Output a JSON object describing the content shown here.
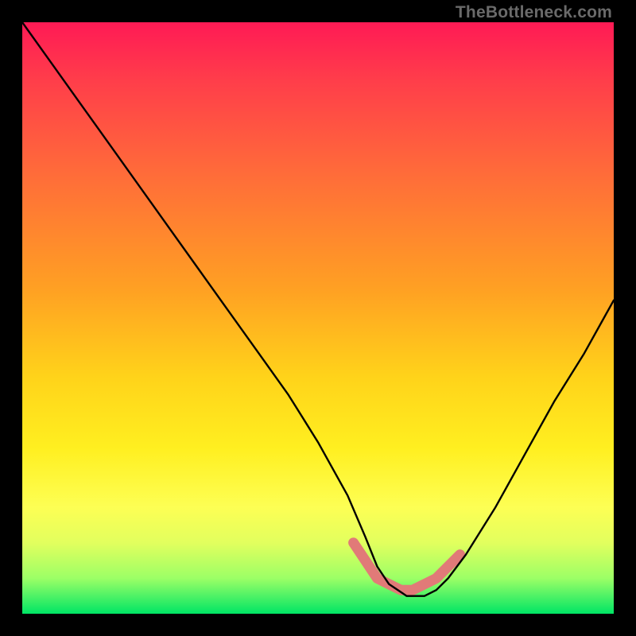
{
  "watermark": "TheBottleneck.com",
  "chart_data": {
    "type": "line",
    "title": "",
    "xlabel": "",
    "ylabel": "",
    "xlim": [
      0,
      100
    ],
    "ylim": [
      0,
      100
    ],
    "series": [
      {
        "name": "bottleneck-curve",
        "x": [
          0,
          5,
          10,
          15,
          20,
          25,
          30,
          35,
          40,
          45,
          50,
          55,
          58,
          60,
          62,
          65,
          68,
          70,
          72,
          75,
          80,
          85,
          90,
          95,
          100
        ],
        "values": [
          100,
          93,
          86,
          79,
          72,
          65,
          58,
          51,
          44,
          37,
          29,
          20,
          13,
          8,
          5,
          3,
          3,
          4,
          6,
          10,
          18,
          27,
          36,
          44,
          53
        ]
      }
    ],
    "highlight_band": {
      "name": "optimal-range",
      "x": [
        56,
        58,
        60,
        62,
        64,
        66,
        68,
        70,
        72,
        74
      ],
      "values": [
        12,
        9,
        6,
        5,
        4,
        4,
        5,
        6,
        8,
        10
      ],
      "color": "#e17a78"
    },
    "gradient_stops": [
      {
        "offset": 0.0,
        "color": "#ff1a55"
      },
      {
        "offset": 0.1,
        "color": "#ff3e4a"
      },
      {
        "offset": 0.25,
        "color": "#ff6a3a"
      },
      {
        "offset": 0.45,
        "color": "#ffa023"
      },
      {
        "offset": 0.6,
        "color": "#ffd31a"
      },
      {
        "offset": 0.72,
        "color": "#ffef20"
      },
      {
        "offset": 0.82,
        "color": "#fdff54"
      },
      {
        "offset": 0.88,
        "color": "#e2ff5e"
      },
      {
        "offset": 0.94,
        "color": "#9cff66"
      },
      {
        "offset": 1.0,
        "color": "#00e565"
      }
    ]
  }
}
